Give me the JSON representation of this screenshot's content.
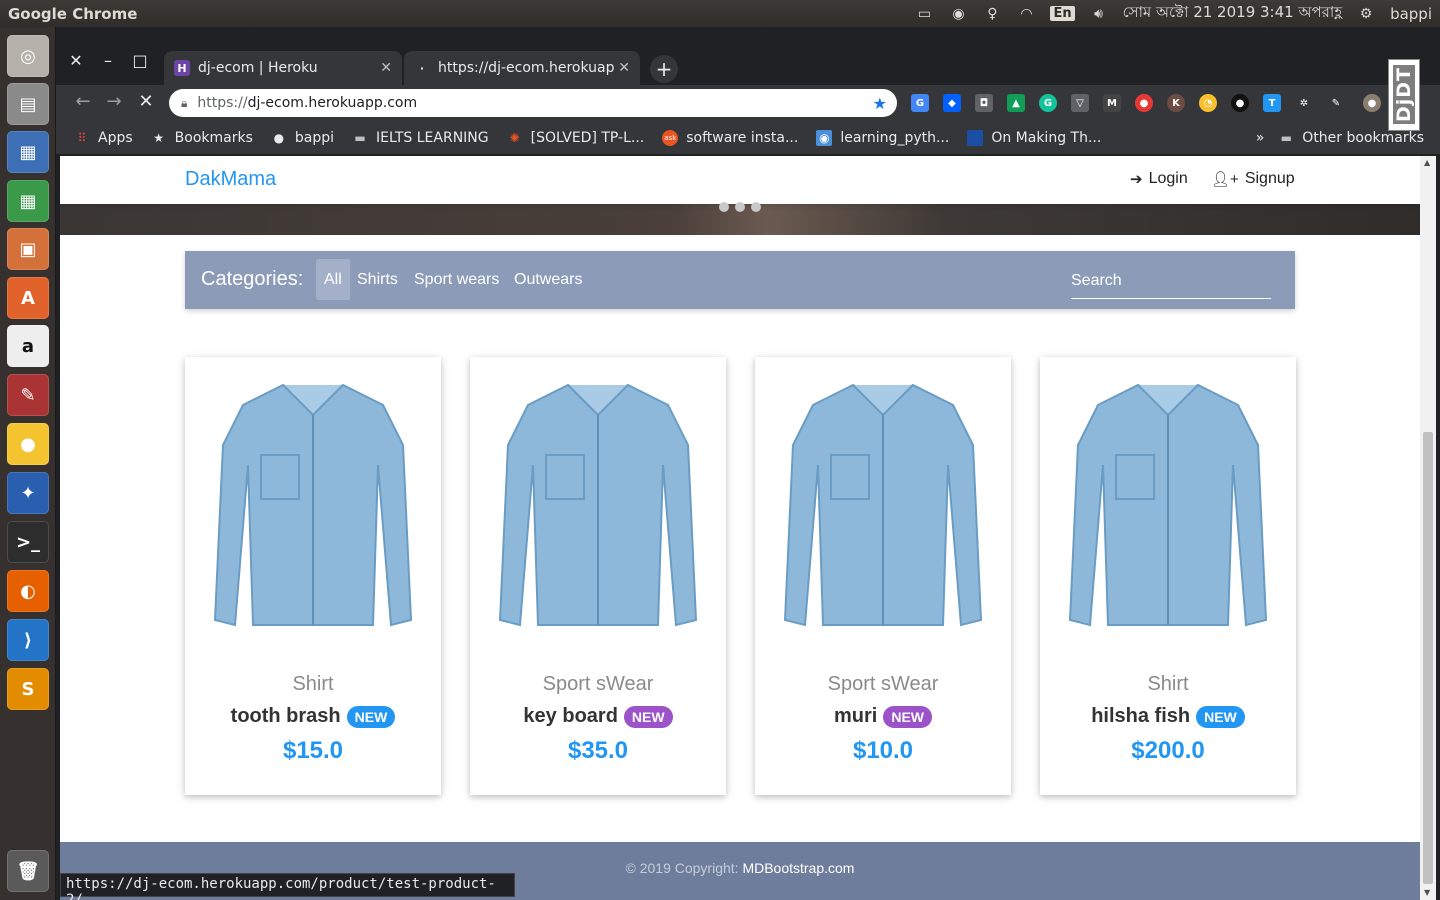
{
  "topbar": {
    "app_name": "Google Chrome",
    "lang": "En",
    "datetime": "সোম অক্টো 21 2019 3:41 অপরাহ্ণ",
    "user": "bappi"
  },
  "tabs": [
    {
      "title": "dj-ecom | Heroku",
      "favicon": "H"
    },
    {
      "title": "https://dj-ecom.herokuap",
      "favicon": "·"
    }
  ],
  "omnibox": {
    "scheme": "https://",
    "host": "dj-ecom.herokuapp.com"
  },
  "bookmarks": [
    {
      "label": "Apps",
      "icon": "apps-grid-icon"
    },
    {
      "label": "Bookmarks",
      "icon": "star-icon"
    },
    {
      "label": "bappi",
      "icon": "github-icon"
    },
    {
      "label": "IELTS LEARNING",
      "icon": "folder-icon"
    },
    {
      "label": "[SOLVED] TP-L...",
      "icon": "ubuntu-icon"
    },
    {
      "label": "software insta...",
      "icon": "askubuntu-icon"
    },
    {
      "label": "learning_pyth...",
      "icon": "blue-icon"
    },
    {
      "label": "On Making Th...",
      "icon": "blue-square-icon"
    }
  ],
  "bookmarks_overflow": "»",
  "other_bookmarks": "Other bookmarks",
  "site": {
    "brand": "DakMama",
    "login": "Login",
    "signup": "Signup",
    "djdt": "DjDT"
  },
  "categories": {
    "title": "Categories:",
    "items": [
      "All",
      "Shirts",
      "Sport wears",
      "Outwears"
    ],
    "active": "All",
    "search_placeholder": "Search"
  },
  "products": [
    {
      "category": "Shirt",
      "name": "tooth brash",
      "badge": "NEW",
      "badge_color": "#2196f3",
      "price": "$15.0"
    },
    {
      "category": "Sport sWear",
      "name": "key board",
      "badge": "NEW",
      "badge_color": "#9c52c8",
      "price": "$35.0"
    },
    {
      "category": "Sport sWear",
      "name": "muri",
      "badge": "NEW",
      "badge_color": "#9c52c8",
      "price": "$10.0"
    },
    {
      "category": "Shirt",
      "name": "hilsha fish",
      "badge": "NEW",
      "badge_color": "#2196f3",
      "price": "$200.0"
    }
  ],
  "footer": {
    "copyright": "© 2019 Copyright:",
    "link": "MDBootstrap.com"
  },
  "status_url": "https://dj-ecom.herokuapp.com/product/test-product-2/",
  "colors": {
    "brand": "#2196f3",
    "category_bar": "#8c9bb8",
    "footer": "#6f7d9d"
  }
}
